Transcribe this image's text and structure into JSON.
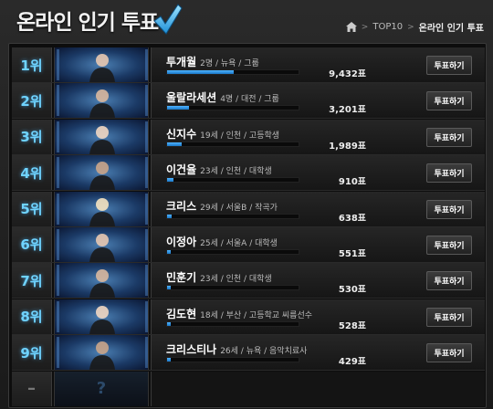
{
  "header": {
    "title": "온라인 인기 투표",
    "breadcrumb": {
      "home_icon": "home-icon",
      "separator": ">",
      "section": "TOP10",
      "current": "온라인 인기 투표"
    }
  },
  "vote_button_label": "투표하기",
  "accent_color": "#6fd3ff",
  "entries": [
    {
      "rank": "1위",
      "name": "투개월",
      "meta": "2명 / 뉴욕 / 그룹",
      "votes": "9,432표",
      "share": 0.51
    },
    {
      "rank": "2위",
      "name": "울랄라세션",
      "meta": "4명 / 대전 / 그룹",
      "votes": "3,201표",
      "share": 0.17
    },
    {
      "rank": "3위",
      "name": "신지수",
      "meta": "19세 / 인천 / 고등학생",
      "votes": "1,989표",
      "share": 0.11
    },
    {
      "rank": "4위",
      "name": "이건율",
      "meta": "23세 / 인천 / 대학생",
      "votes": "910표",
      "share": 0.05
    },
    {
      "rank": "5위",
      "name": "크리스",
      "meta": "29세 / 서울B / 작곡가",
      "votes": "638표",
      "share": 0.035
    },
    {
      "rank": "6위",
      "name": "이정아",
      "meta": "25세 / 서울A / 대학생",
      "votes": "551표",
      "share": 0.03
    },
    {
      "rank": "7위",
      "name": "민훈기",
      "meta": "23세 / 인천 / 대학생",
      "votes": "530표",
      "share": 0.03
    },
    {
      "rank": "8위",
      "name": "김도현",
      "meta": "18세 / 부산 / 고등학교 씨름선수",
      "votes": "528표",
      "share": 0.03
    },
    {
      "rank": "9위",
      "name": "크리스티나",
      "meta": "26세 / 뉴욕 / 음악치료사",
      "votes": "429표",
      "share": 0.025
    }
  ],
  "empty_row": {
    "rank": "–",
    "thumb_text": "?"
  }
}
